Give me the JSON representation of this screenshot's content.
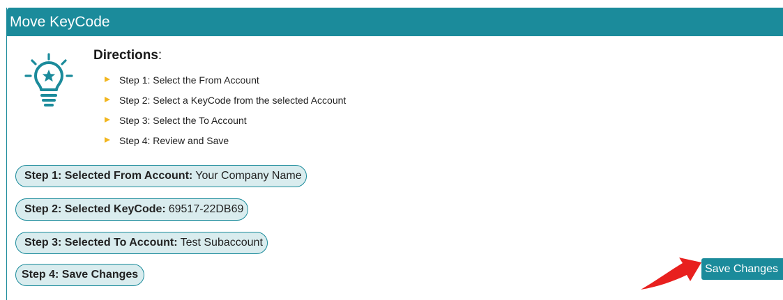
{
  "header": {
    "title": "Move KeyCode"
  },
  "directions": {
    "title": "Directions",
    "colon": ":",
    "steps": [
      "Step 1: Select the From Account",
      "Step 2: Select a KeyCode from the selected Account",
      "Step 3: Select the To Account",
      "Step 4: Review and Save"
    ]
  },
  "summary": {
    "step1": {
      "label": "Step 1: Selected From Account:",
      "value": "Your Company Name"
    },
    "step2": {
      "label": "Step 2: Selected KeyCode:",
      "value": "69517-22DB69"
    },
    "step3": {
      "label": "Step 3: Selected To Account:",
      "value": "Test Subaccount"
    },
    "step4": {
      "label": "Step 4: Save Changes"
    }
  },
  "actions": {
    "save_label": "Save Changes"
  },
  "icons": {
    "directions_icon": "lightbulb-star-icon",
    "step_bullet": "triangle-bullet-icon",
    "annotation": "red-arrow-icon"
  },
  "colors": {
    "primary": "#1b8b9b",
    "pill_bg": "#d9ecee",
    "bullet": "#f2b61f",
    "annotation": "#e8201e"
  }
}
